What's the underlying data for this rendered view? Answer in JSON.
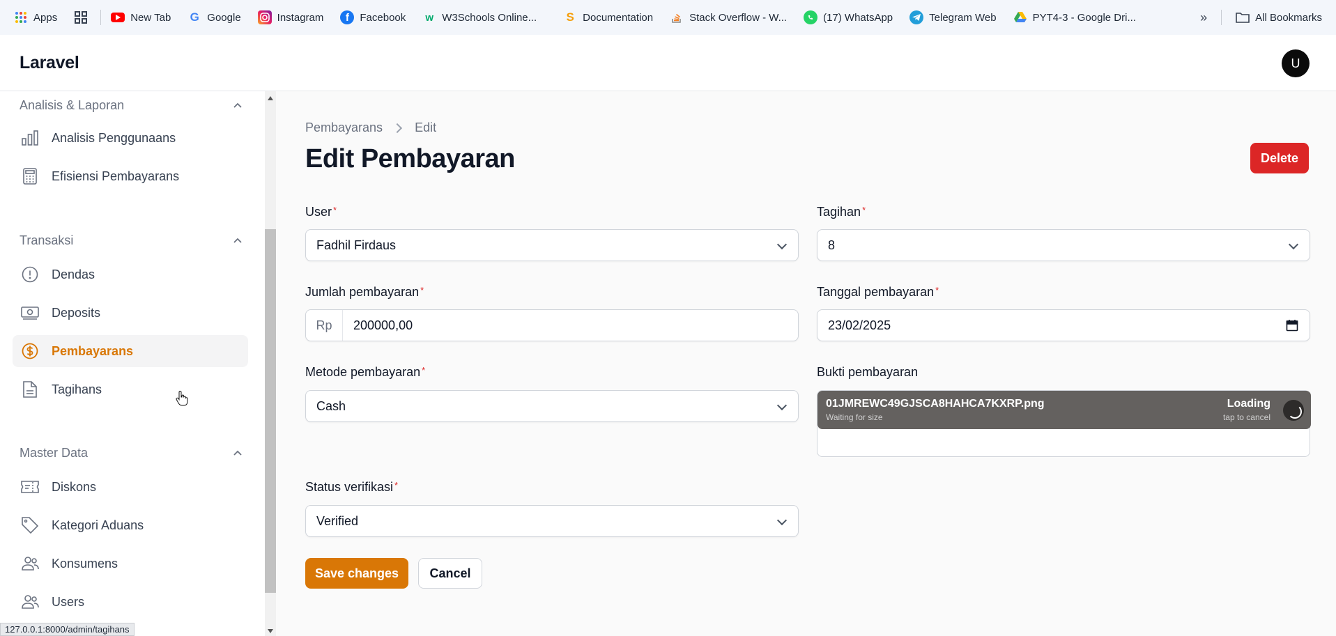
{
  "bookmarks": {
    "items": [
      {
        "label": "Apps",
        "icon": "apps-grid-icon"
      },
      {
        "label": "New Tab",
        "icon": "youtube-icon"
      },
      {
        "label": "Google",
        "icon": "google-icon"
      },
      {
        "label": "Instagram",
        "icon": "instagram-icon"
      },
      {
        "label": "Facebook",
        "icon": "facebook-icon"
      },
      {
        "label": "W3Schools Online...",
        "icon": "w3schools-icon"
      },
      {
        "label": "Documentation",
        "icon": "documentation-icon"
      },
      {
        "label": "Stack Overflow - W...",
        "icon": "stackoverflow-icon"
      },
      {
        "label": "(17) WhatsApp",
        "icon": "whatsapp-icon"
      },
      {
        "label": "Telegram Web",
        "icon": "telegram-icon"
      },
      {
        "label": "PYT4-3 - Google Dri...",
        "icon": "google-drive-icon"
      }
    ],
    "all_bookmarks": "All Bookmarks"
  },
  "header": {
    "brand": "Laravel",
    "avatar_initial": "U"
  },
  "sidebar": {
    "groups": [
      {
        "label": "Analisis & Laporan",
        "items": [
          {
            "label": "Analisis Penggunaans",
            "icon": "bar-chart-icon"
          },
          {
            "label": "Efisiensi Pembayarans",
            "icon": "calculator-icon"
          }
        ]
      },
      {
        "label": "Transaksi",
        "items": [
          {
            "label": "Dendas",
            "icon": "exclamation-circle-icon"
          },
          {
            "label": "Deposits",
            "icon": "banknote-icon"
          },
          {
            "label": "Pembayarans",
            "icon": "dollar-circle-icon",
            "active": true
          },
          {
            "label": "Tagihans",
            "icon": "document-icon"
          }
        ]
      },
      {
        "label": "Master Data",
        "items": [
          {
            "label": "Diskons",
            "icon": "ticket-icon"
          },
          {
            "label": "Kategori Aduans",
            "icon": "tag-icon"
          },
          {
            "label": "Konsumens",
            "icon": "users-icon"
          },
          {
            "label": "Users",
            "icon": "users-icon"
          }
        ]
      }
    ]
  },
  "status_url": "127.0.0.1:8000/admin/tagihans",
  "main": {
    "breadcrumb": [
      "Pembayarans",
      "Edit"
    ],
    "title": "Edit Pembayaran",
    "delete_label": "Delete",
    "fields": {
      "user": {
        "label": "User",
        "value": "Fadhil Firdaus"
      },
      "tagihan": {
        "label": "Tagihan",
        "value": "8"
      },
      "jumlah": {
        "label": "Jumlah pembayaran",
        "prefix": "Rp",
        "value": "200000,00"
      },
      "tanggal": {
        "label": "Tanggal pembayaran",
        "value": "23/02/2025"
      },
      "metode": {
        "label": "Metode pembayaran",
        "value": "Cash"
      },
      "bukti": {
        "label": "Bukti pembayaran",
        "file_name": "01JMREWC49GJSCA8HAHCA7KXRP.png",
        "file_sub": "Waiting for size",
        "status": "Loading",
        "tap": "tap to cancel"
      },
      "status": {
        "label": "Status verifikasi",
        "value": "Verified"
      }
    },
    "save_label": "Save changes",
    "cancel_label": "Cancel"
  },
  "colors": {
    "accent": "#d97706",
    "danger": "#dc2626"
  }
}
